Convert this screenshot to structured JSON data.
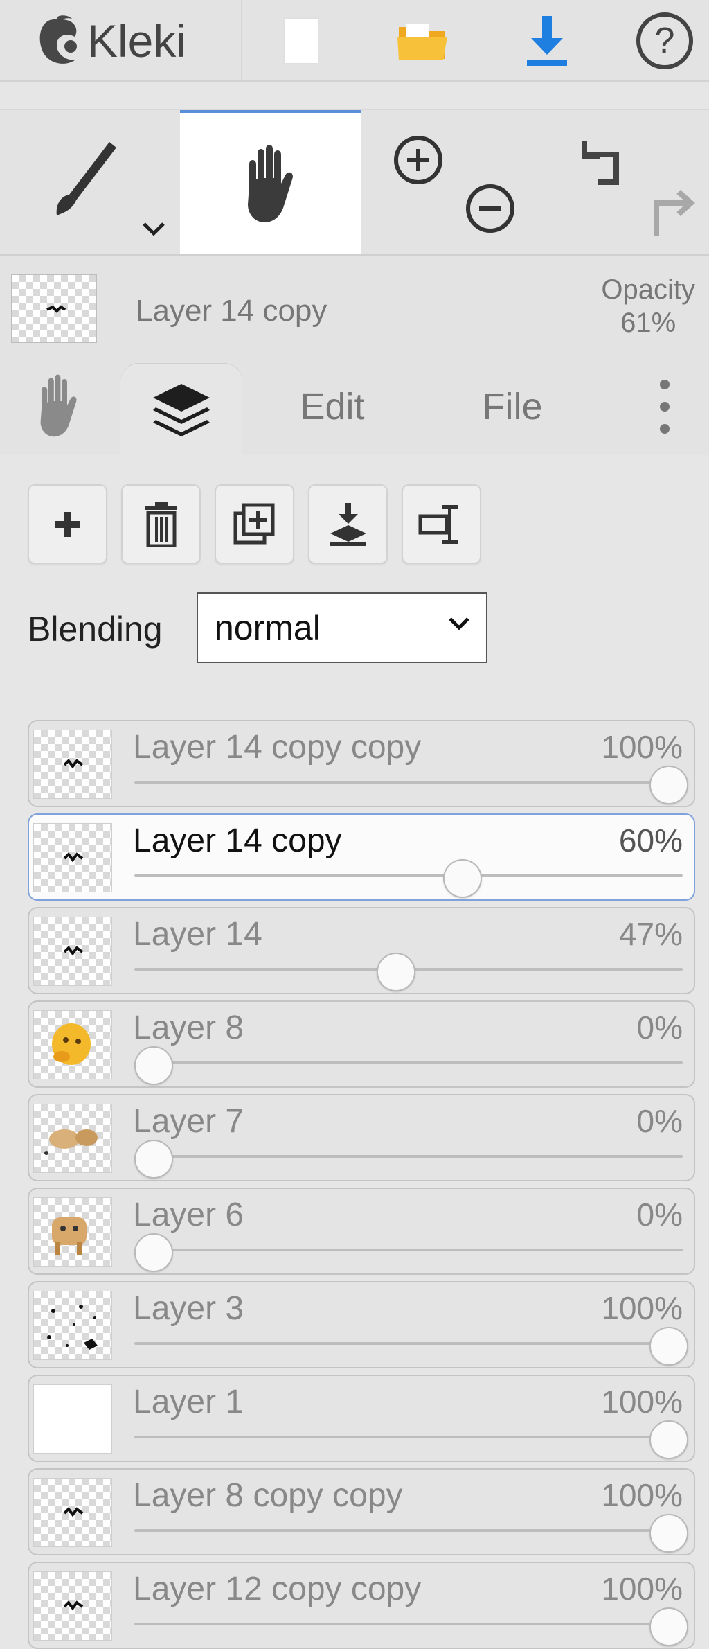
{
  "app": {
    "logo_text": "Kleki"
  },
  "topbar": {
    "buttons": [
      {
        "icon": "new-page-icon"
      },
      {
        "icon": "folder-open-icon"
      },
      {
        "icon": "download-icon"
      },
      {
        "icon": "help-icon"
      }
    ]
  },
  "tools": {
    "brush": {
      "icon": "brush-icon",
      "dropdown_icon": "chevron-down-icon"
    },
    "hand": {
      "icon": "hand-icon",
      "active": true
    },
    "zoom_in": {
      "icon": "zoom-in-icon"
    },
    "zoom_out": {
      "icon": "zoom-out-icon"
    },
    "undo": {
      "icon": "undo-icon"
    },
    "redo": {
      "icon": "redo-icon"
    }
  },
  "current_layer": {
    "name": "Layer 14 copy",
    "opacity_label": "Opacity",
    "opacity_value": "61%"
  },
  "tabs": {
    "hand_icon": "hand-icon",
    "layers_icon": "layers-icon",
    "edit": "Edit",
    "file": "File",
    "more_icon": "more-vertical-icon"
  },
  "layer_actions": [
    {
      "icon": "add-layer-icon"
    },
    {
      "icon": "delete-layer-icon"
    },
    {
      "icon": "duplicate-layer-icon"
    },
    {
      "icon": "merge-down-icon"
    },
    {
      "icon": "rename-layer-icon"
    }
  ],
  "blending": {
    "label": "Blending",
    "value": "normal"
  },
  "layers": [
    {
      "name": "Layer 14 copy copy",
      "opacity": "100%",
      "level": 1.0,
      "selected": false,
      "thumb": "checker-mark"
    },
    {
      "name": "Layer 14 copy",
      "opacity": "60%",
      "level": 0.6,
      "selected": true,
      "thumb": "checker-mark"
    },
    {
      "name": "Layer 14",
      "opacity": "47%",
      "level": 0.47,
      "selected": false,
      "thumb": "checker-mark"
    },
    {
      "name": "Layer 8",
      "opacity": "0%",
      "level": 0.0,
      "selected": false,
      "thumb": "yellow-blob"
    },
    {
      "name": "Layer 7",
      "opacity": "0%",
      "level": 0.0,
      "selected": false,
      "thumb": "tan-shape"
    },
    {
      "name": "Layer 6",
      "opacity": "0%",
      "level": 0.0,
      "selected": false,
      "thumb": "dog-figure"
    },
    {
      "name": "Layer 3",
      "opacity": "100%",
      "level": 1.0,
      "selected": false,
      "thumb": "scatter-marks"
    },
    {
      "name": "Layer 1",
      "opacity": "100%",
      "level": 1.0,
      "selected": false,
      "thumb": "white"
    },
    {
      "name": "Layer 8 copy copy",
      "opacity": "100%",
      "level": 1.0,
      "selected": false,
      "thumb": "checker-mark"
    },
    {
      "name": "Layer 12 copy copy",
      "opacity": "100%",
      "level": 1.0,
      "selected": false,
      "thumb": "checker-mark"
    }
  ],
  "colors": {
    "accent": "#5b8fd9",
    "download": "#1f7fe0",
    "folder": "#f5b82e"
  }
}
